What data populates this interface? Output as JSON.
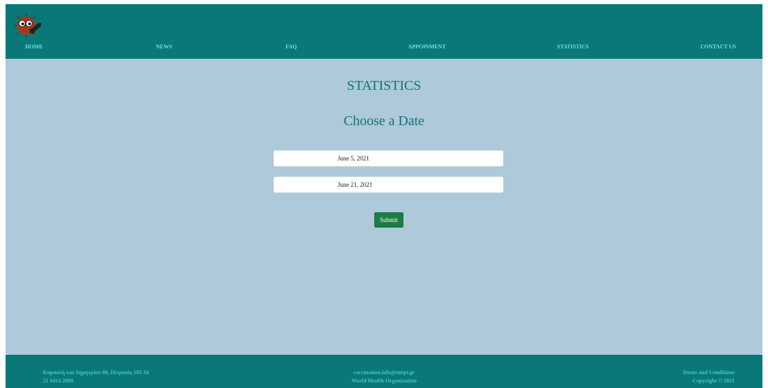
{
  "nav": {
    "items": [
      {
        "label": "HOME"
      },
      {
        "label": "NEWS"
      },
      {
        "label": "FAQ"
      },
      {
        "label": "APPOINMENT"
      },
      {
        "label": "STATISTICS"
      },
      {
        "label": "CONTACT US"
      }
    ]
  },
  "logo": {
    "icon": "virus-syringe-logo-icon"
  },
  "main": {
    "title": "STATISTICS",
    "subtitle": "Choose a Date",
    "start_date": {
      "value": "June 5, 2021"
    },
    "end_date": {
      "value": "June 21, 2021"
    },
    "submit_label": "Submit"
  },
  "footer": {
    "address": "Καραολή και Δημητρίου 80, Πειραιάς 185 34",
    "phone": "21 0414 2000",
    "email": "vaccination.info@unipi.gr",
    "organization": "World Health Organization",
    "terms": "Terms and Conditions",
    "copyright": "Copyright © 2021"
  },
  "colors": {
    "header_bg": "#0a7878",
    "page_bg": "#adc9da",
    "nav_text": "#66e6e6",
    "title_text": "#127474",
    "submit_bg": "#1a7f43",
    "footer_text": "#3ec6c8"
  }
}
